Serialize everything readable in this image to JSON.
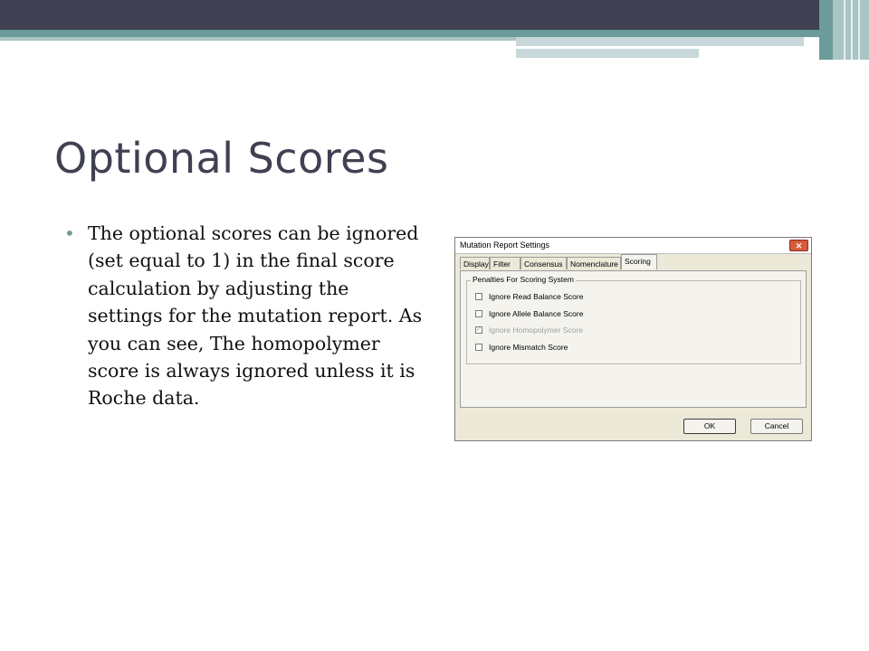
{
  "slide": {
    "title": "Optional Scores",
    "bullet": "The optional scores can be ignored (set equal to 1) in the final score calculation by adjusting the settings for the mutation report.  As you can see, The homopolymer score is always ignored unless it is Roche data."
  },
  "dialog": {
    "title": "Mutation Report Settings",
    "close_icon": "close-icon",
    "tabs": [
      "Display",
      "Filter",
      "Consensus",
      "Nomenclature",
      "Scoring"
    ],
    "active_tab": "Scoring",
    "group_label": "Penalties For Scoring System",
    "options": [
      {
        "label": "Ignore Read Balance Score",
        "checked": false,
        "disabled": false
      },
      {
        "label": "Ignore Allele Balance Score",
        "checked": false,
        "disabled": false
      },
      {
        "label": "Ignore Homopolymer Score",
        "checked": true,
        "disabled": true
      },
      {
        "label": "Ignore Mismatch Score",
        "checked": false,
        "disabled": false
      }
    ],
    "ok_label": "OK",
    "cancel_label": "Cancel"
  },
  "colors": {
    "title": "#3f4152",
    "accent": "#6b9b9b"
  }
}
